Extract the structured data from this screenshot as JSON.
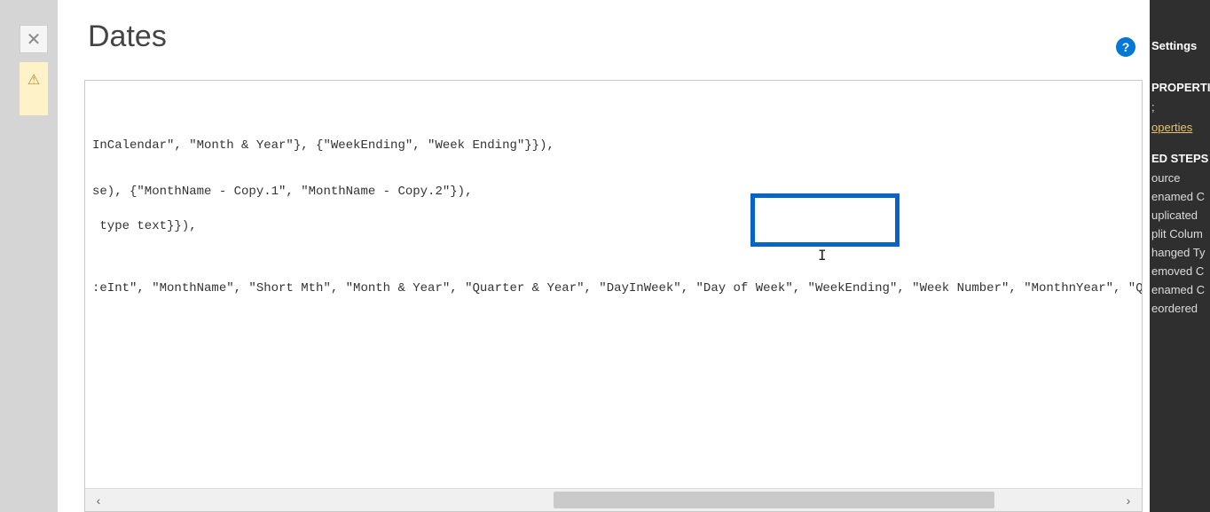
{
  "page_title": "Dates",
  "close_glyph": "✕",
  "warning_glyph": "⚠",
  "help_glyph": "?",
  "code": {
    "line1": "InCalendar\", \"Month & Year\"}, {\"WeekEnding\", \"Week Ending\"}}),",
    "line2": "se), {\"MonthName - Copy.1\", \"MonthName - Copy.2\"}),",
    "line3": " type text}}),",
    "line4_prefix": ":eInt\", \"MonthName\", \"Short Mth\", \"Month & Year\", \"Quarter & Year\", \"DayInWeek\", \"Day of Week\",",
    "line4_highlight": " \"WeekEnding\", \"We",
    "line4_suffix": "ek Number\", \"MonthnYear\", \"Quar"
  },
  "scroll": {
    "left_glyph": "‹",
    "right_glyph": "›"
  },
  "cursor_glyph": "I",
  "right_panel": {
    "settings": "Settings",
    "properties_header": "PROPERTIES",
    "gap_item": ";",
    "properties_link": "operties",
    "steps_header": "ED STEPS",
    "steps": [
      "ource",
      "enamed C",
      "uplicated",
      "plit Colum",
      "hanged Ty",
      "emoved C",
      "enamed C",
      "eordered"
    ]
  }
}
